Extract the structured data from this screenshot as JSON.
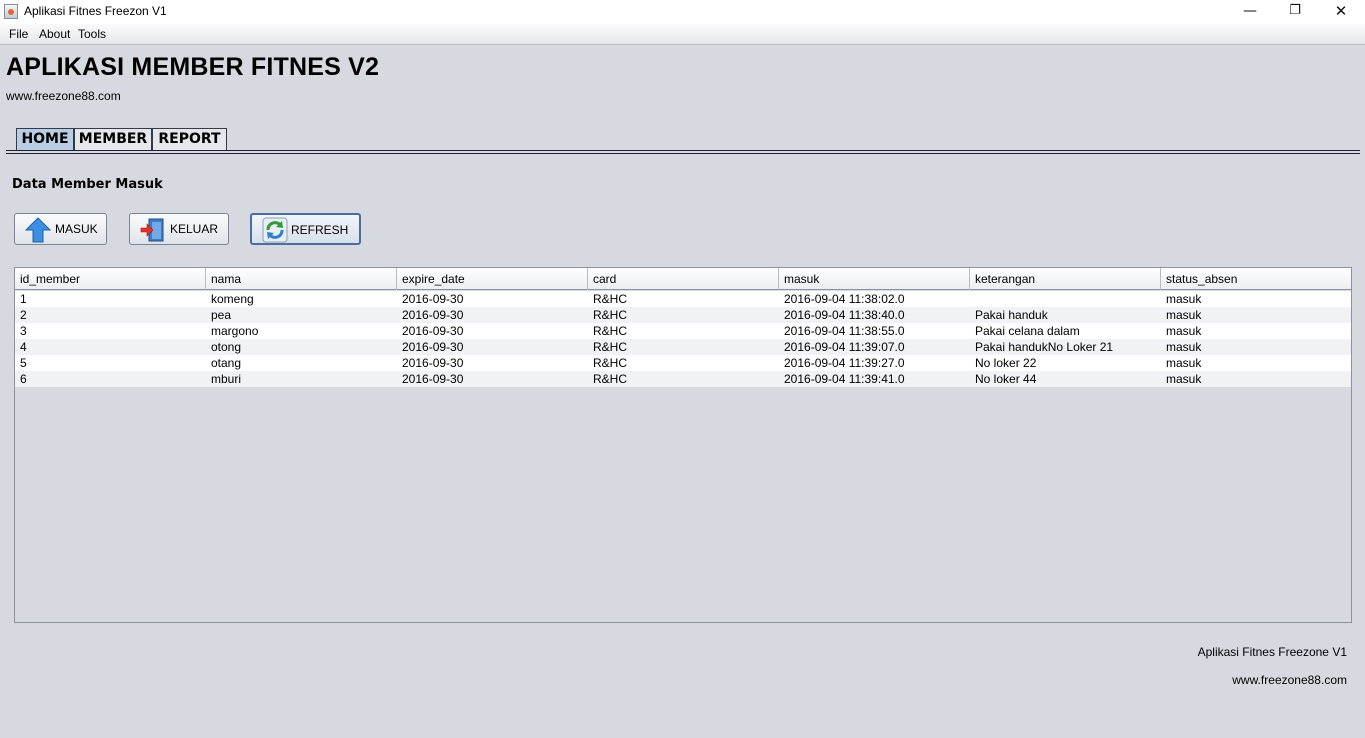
{
  "window": {
    "title": "Aplikasi Fitnes Freezon V1",
    "minimize_icon": "minimize-icon",
    "maximize_icon": "restore-icon",
    "close_icon": "close-icon"
  },
  "menubar": {
    "items": [
      "File",
      "About",
      "Tools"
    ]
  },
  "header": {
    "title": "APLIKASI MEMBER FITNES V2",
    "url": "www.freezone88.com"
  },
  "tabs": [
    {
      "label": "HOME",
      "active": true
    },
    {
      "label": "MEMBER",
      "active": false
    },
    {
      "label": "REPORT",
      "active": false
    }
  ],
  "section": {
    "title": "Data Member Masuk"
  },
  "buttons": {
    "masuk": {
      "label": "MASUK",
      "icon": "arrow-up-icon"
    },
    "keluar": {
      "label": "KELUAR",
      "icon": "exit-door-icon"
    },
    "refresh": {
      "label": "REFRESH",
      "icon": "refresh-icon"
    }
  },
  "table": {
    "columns": [
      "id_member",
      "nama",
      "expire_date",
      "card",
      "masuk",
      "keterangan",
      "status_absen"
    ],
    "rows": [
      [
        "1",
        "komeng",
        "2016-09-30",
        "R&HC",
        "2016-09-04 11:38:02.0",
        "",
        "masuk"
      ],
      [
        "2",
        "pea",
        "2016-09-30",
        "R&HC",
        "2016-09-04 11:38:40.0",
        "Pakai handuk",
        "masuk"
      ],
      [
        "3",
        "margono",
        "2016-09-30",
        "R&HC",
        "2016-09-04 11:38:55.0",
        "Pakai celana dalam",
        "masuk"
      ],
      [
        "4",
        "otong",
        "2016-09-30",
        "R&HC",
        "2016-09-04 11:39:07.0",
        "Pakai handukNo Loker 21",
        "masuk"
      ],
      [
        "5",
        "otang",
        "2016-09-30",
        "R&HC",
        "2016-09-04 11:39:27.0",
        "No loker 22",
        "masuk"
      ],
      [
        "6",
        "mburi",
        "2016-09-30",
        "R&HC",
        "2016-09-04 11:39:41.0",
        "No loker 44",
        "masuk"
      ]
    ]
  },
  "footer": {
    "app_name": "Aplikasi Fitnes Freezone V1",
    "url": "www.freezone88.com"
  },
  "colors": {
    "background": "#d6d9df",
    "active_tab": "#b9cde4",
    "refresh_border": "#4a6da0"
  }
}
